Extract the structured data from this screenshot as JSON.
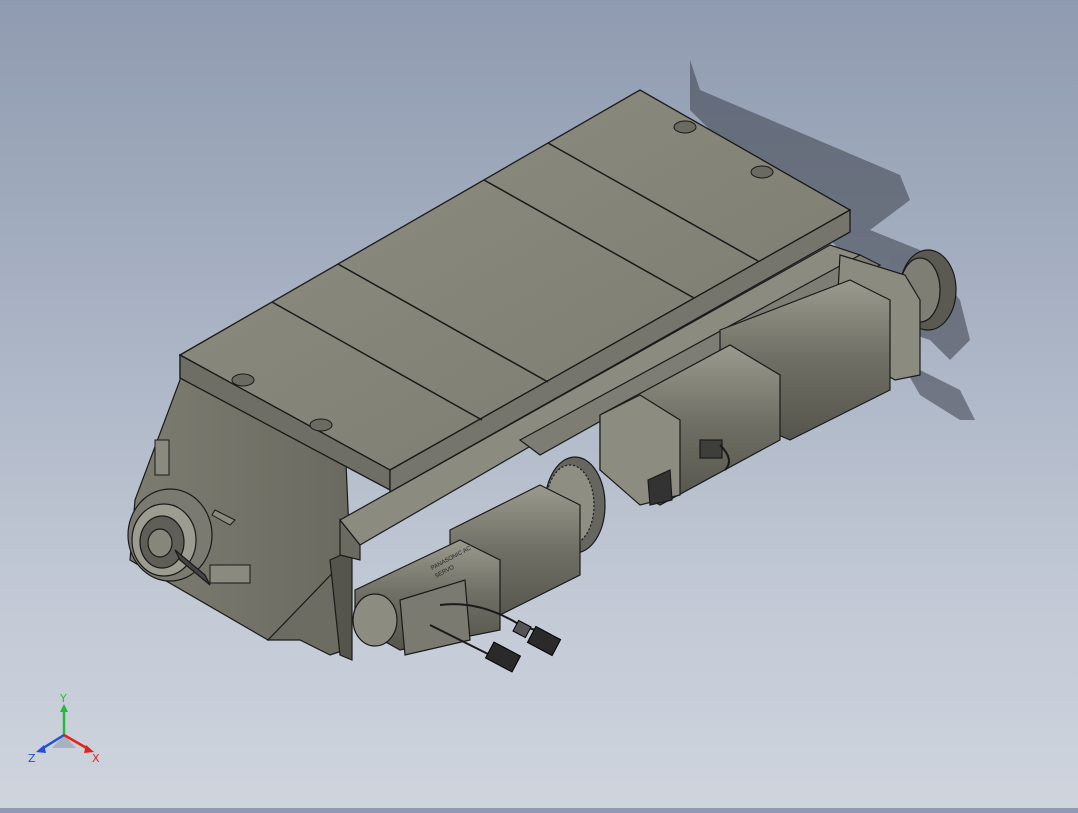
{
  "viewport": {
    "background_top": "#8f9bb0",
    "background_bottom": "#cfd4dd",
    "model_color": "#8a8a7e",
    "model_dark": "#5e5e55",
    "model_light": "#a3a396",
    "edge_color": "#1a1a1a"
  },
  "motor_labels": {
    "label_line1": "PANASONIC  AC",
    "label_line2": "SERVO"
  },
  "triad": {
    "y_label": "Y",
    "x_label": "X",
    "z_label": "Z",
    "y_color": "#27b83a",
    "x_color": "#e0241b",
    "z_color": "#2350d8"
  }
}
